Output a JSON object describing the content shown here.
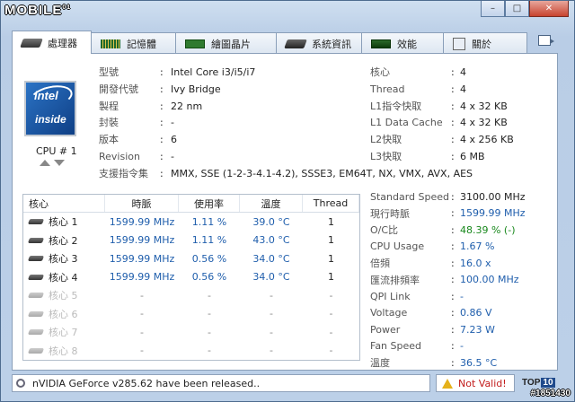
{
  "window": {
    "logo_text": "MOBILE",
    "logo_small": "01",
    "buttons": {
      "minimize": "–",
      "maximize": "□",
      "close": "✕"
    }
  },
  "tabs": [
    {
      "label": "處理器",
      "icon": "cpu-icon"
    },
    {
      "label": "記憶體",
      "icon": "memory-icon"
    },
    {
      "label": "繪圖晶片",
      "icon": "graphics-card-icon"
    },
    {
      "label": "系統資訊",
      "icon": "system-icon"
    },
    {
      "label": "效能",
      "icon": "performance-icon"
    },
    {
      "label": "關於",
      "icon": "about-icon"
    }
  ],
  "cpu_selector": {
    "label": "CPU # 1"
  },
  "processor": [
    {
      "key": "型號",
      "value": "Intel Core i3/i5/i7"
    },
    {
      "key": "開發代號",
      "value": "Ivy Bridge"
    },
    {
      "key": "製程",
      "value": "22 nm"
    },
    {
      "key": "封裝",
      "value": "-"
    },
    {
      "key": "版本",
      "value": "6"
    },
    {
      "key": "Revision",
      "value": "-"
    },
    {
      "key": "支援指令集",
      "value": "MMX, SSE (1-2-3-4.1-4.2), SSSE3, EM64T, NX, VMX, AVX, AES"
    }
  ],
  "cache": [
    {
      "key": "核心",
      "value": "4"
    },
    {
      "key": "Thread",
      "value": "4"
    },
    {
      "key": "L1指令快取",
      "value": "4 x 32 KB"
    },
    {
      "key": "L1 Data Cache",
      "value": "4 x 32 KB"
    },
    {
      "key": "L2快取",
      "value": "4 x 256 KB"
    },
    {
      "key": "L3快取",
      "value": "6 MB"
    }
  ],
  "cores_table": {
    "headers": [
      "核心",
      "時脈",
      "使用率",
      "溫度",
      "Thread"
    ],
    "rows": [
      {
        "name": "核心 1",
        "clock": "1599.99 MHz",
        "usage": "1.11 %",
        "temp": "39.0 °C",
        "thread": "1",
        "active": true
      },
      {
        "name": "核心 2",
        "clock": "1599.99 MHz",
        "usage": "1.11 %",
        "temp": "43.0 °C",
        "thread": "1",
        "active": true
      },
      {
        "name": "核心 3",
        "clock": "1599.99 MHz",
        "usage": "0.56 %",
        "temp": "34.0 °C",
        "thread": "1",
        "active": true
      },
      {
        "name": "核心 4",
        "clock": "1599.99 MHz",
        "usage": "0.56 %",
        "temp": "34.0 °C",
        "thread": "1",
        "active": true
      },
      {
        "name": "核心 5",
        "clock": "-",
        "usage": "-",
        "temp": "-",
        "thread": "-",
        "active": false
      },
      {
        "name": "核心 6",
        "clock": "-",
        "usage": "-",
        "temp": "-",
        "thread": "-",
        "active": false
      },
      {
        "name": "核心 7",
        "clock": "-",
        "usage": "-",
        "temp": "-",
        "thread": "-",
        "active": false
      },
      {
        "name": "核心 8",
        "clock": "-",
        "usage": "-",
        "temp": "-",
        "thread": "-",
        "active": false
      }
    ]
  },
  "stats": [
    {
      "key": "Standard Speed",
      "value": "3100.00 MHz",
      "color": "black"
    },
    {
      "key": "現行時脈",
      "value": "1599.99 MHz",
      "color": "blue"
    },
    {
      "key": "O/C比",
      "value": "48.39 % (-)",
      "color": "green"
    },
    {
      "key": "CPU Usage",
      "value": "1.67 %",
      "color": "blue"
    },
    {
      "key": "倍頻",
      "value": "16.0 x",
      "color": "blue"
    },
    {
      "key": "匯流排頻率",
      "value": "100.00 MHz",
      "color": "blue"
    },
    {
      "key": "QPI Link",
      "value": "-",
      "color": "blue"
    },
    {
      "key": "Voltage",
      "value": "0.86 V",
      "color": "blue"
    },
    {
      "key": "Power",
      "value": "7.23 W",
      "color": "blue"
    },
    {
      "key": "Fan Speed",
      "value": "-",
      "color": "blue"
    },
    {
      "key": "溫度",
      "value": "36.5 °C",
      "color": "blue"
    }
  ],
  "colors": {
    "value_blue": "#1f5eac",
    "value_green": "#18881c",
    "invalid_red": "#c21b1b"
  },
  "intel_logo": {
    "brand": "intel",
    "tagline": "inside"
  },
  "statusbar": {
    "message": "nVIDIA GeForce v285.62 have been released..",
    "validation": "Not Valid!",
    "top10_text": "TOP",
    "top10_num": "10"
  },
  "watermark": "#1851430"
}
